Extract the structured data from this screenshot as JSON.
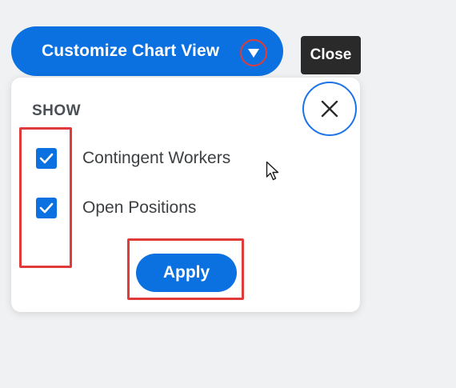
{
  "header": {
    "customize_label": "Customize Chart View"
  },
  "tooltip": {
    "text": "Close"
  },
  "panel": {
    "heading": "SHOW",
    "options": [
      {
        "label": "Contingent Workers",
        "checked": true
      },
      {
        "label": "Open Positions",
        "checked": true
      }
    ],
    "apply_label": "Apply"
  },
  "colors": {
    "primary": "#0b71e0",
    "highlight": "#e03b3b",
    "tooltip_bg": "#2a2a2a"
  },
  "icons": {
    "dropdown": "chevron-down-icon",
    "close": "close-icon",
    "check": "check-icon",
    "cursor": "mouse-pointer-icon"
  }
}
